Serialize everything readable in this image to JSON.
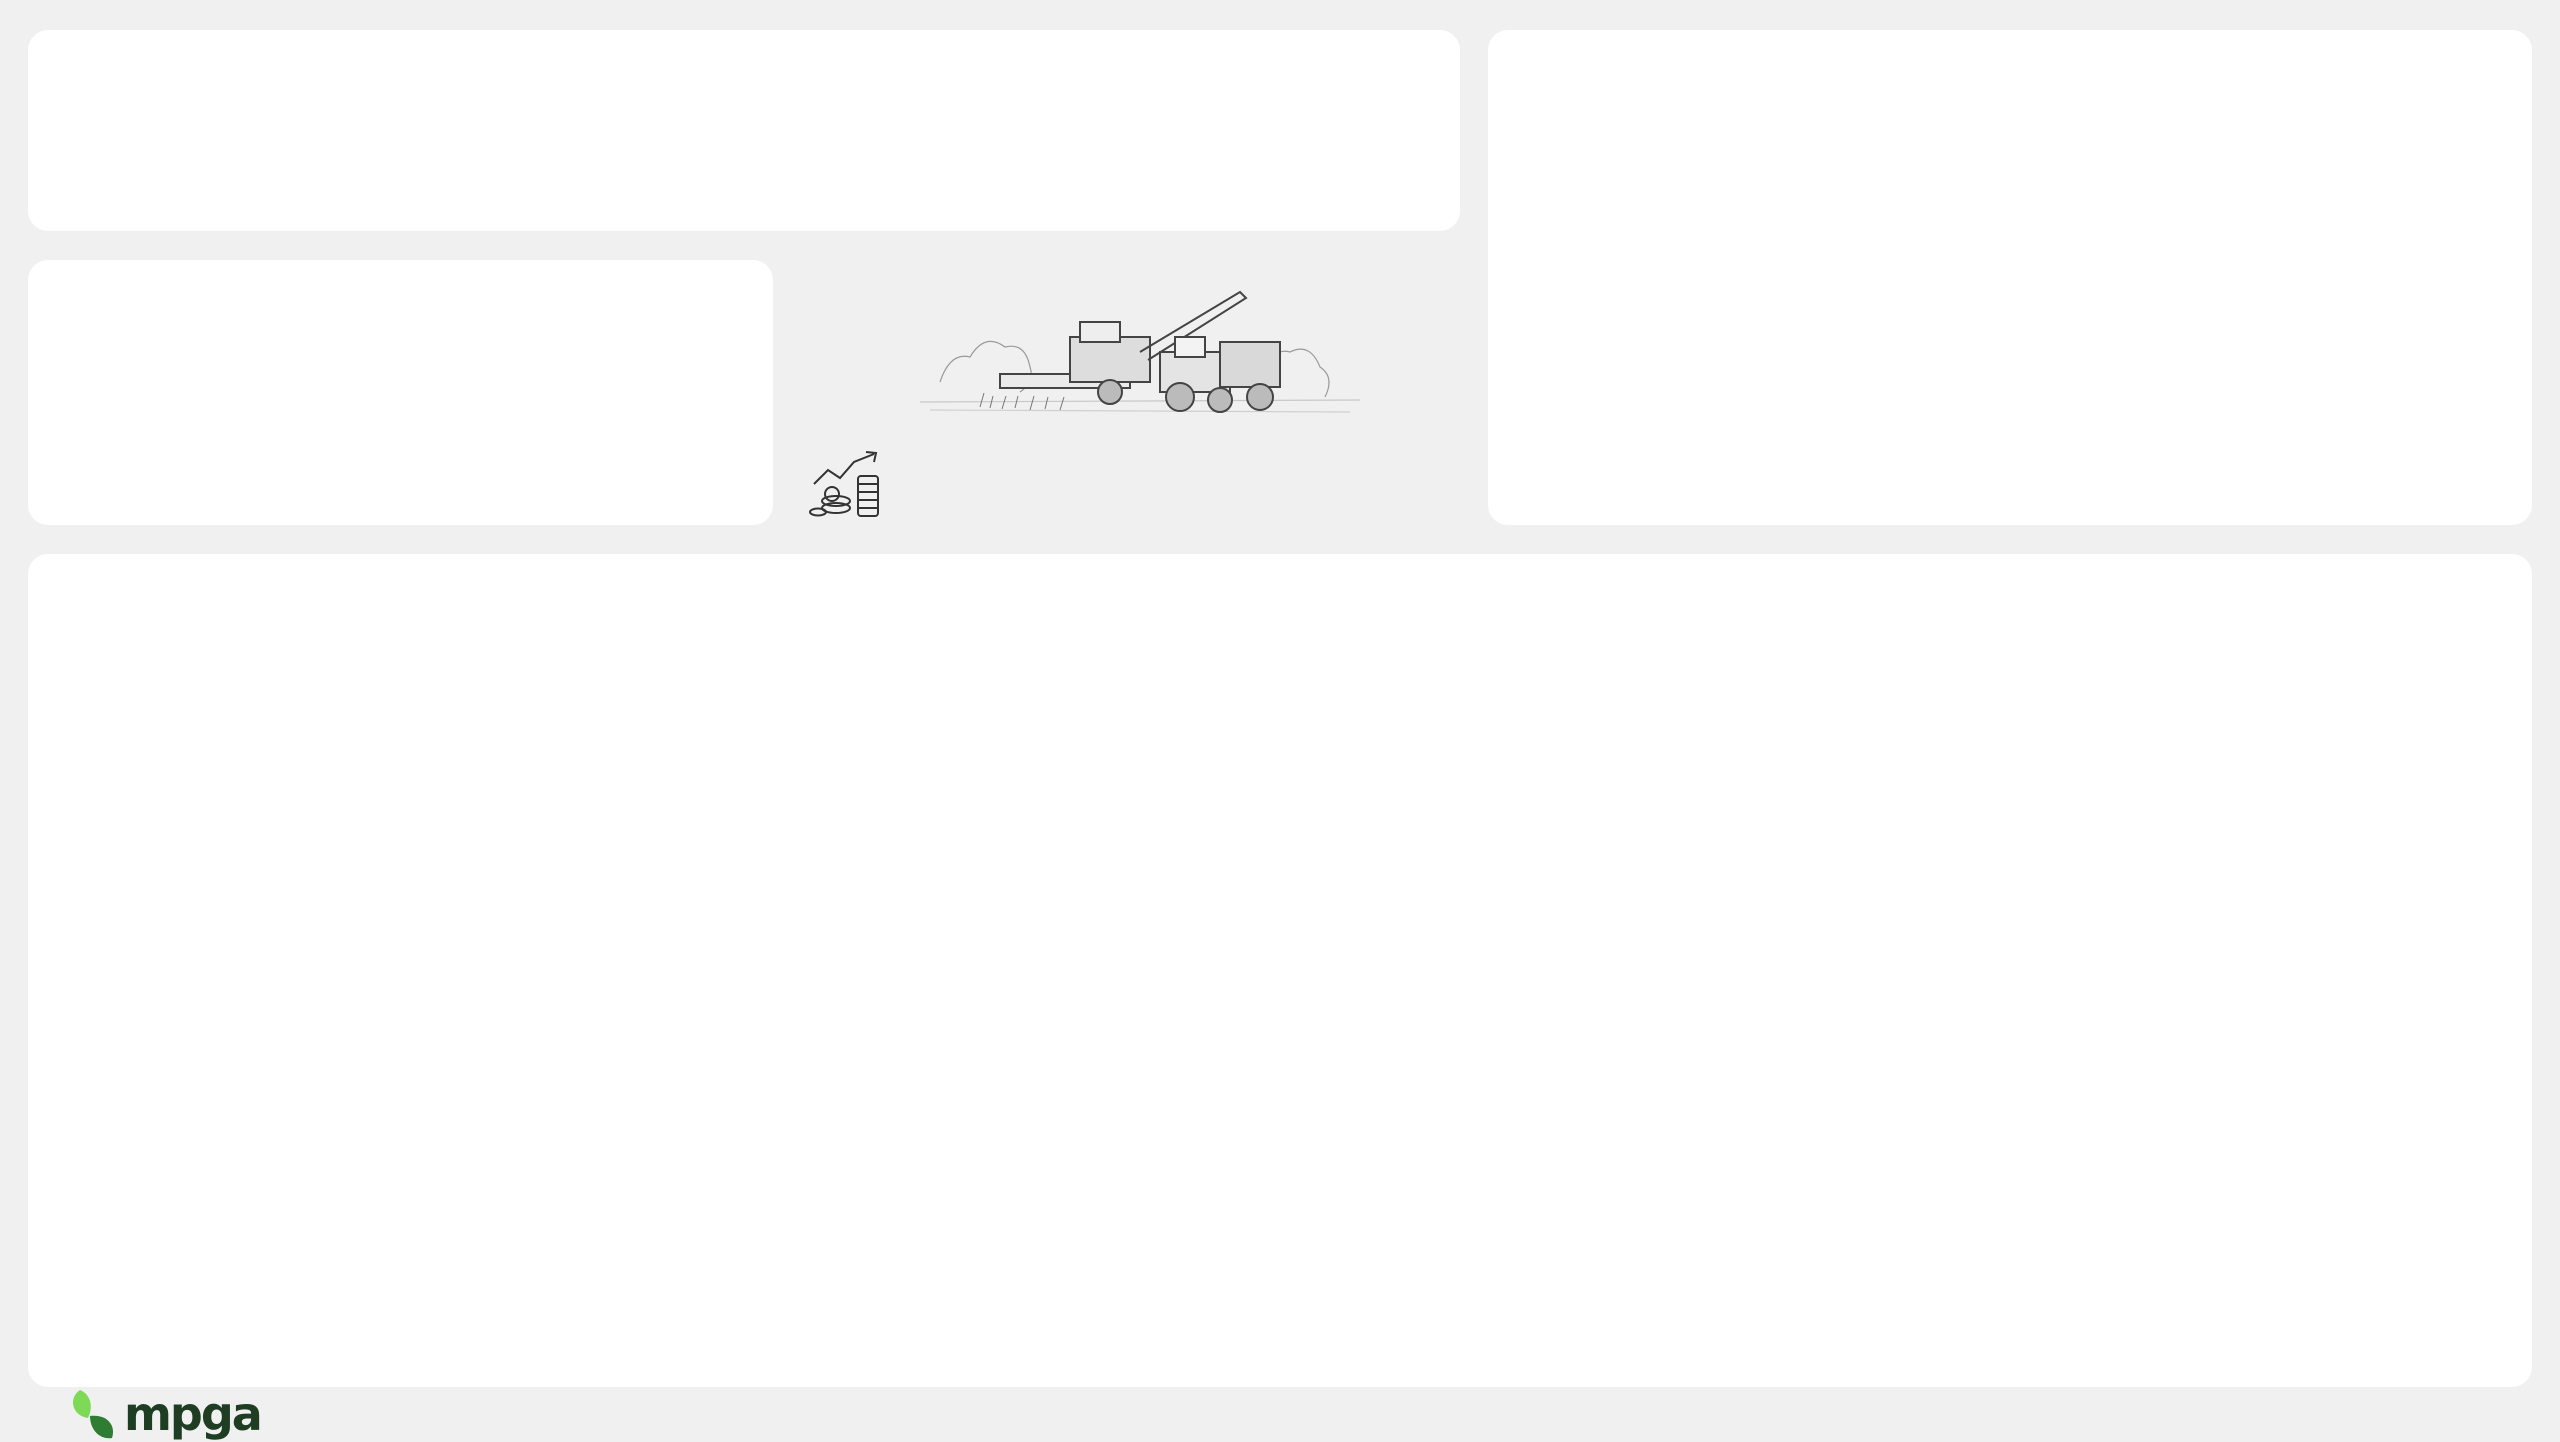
{
  "brand": {
    "name": "mpga",
    "text_color": "#1f3d23",
    "leaf_light": "#7ed957",
    "leaf_dark": "#2e7d32"
  },
  "panels": [
    {
      "id": "top-left",
      "empty": true
    },
    {
      "id": "right",
      "empty": true
    },
    {
      "id": "mid-left",
      "empty": true
    },
    {
      "id": "bottom",
      "empty": true
    }
  ],
  "illustrations": {
    "harvester": "combine-harvester-sketch",
    "growth": "coins-growth-chart-icon"
  },
  "colors": {
    "background": "#f0f0f0",
    "panel": "#ffffff"
  }
}
